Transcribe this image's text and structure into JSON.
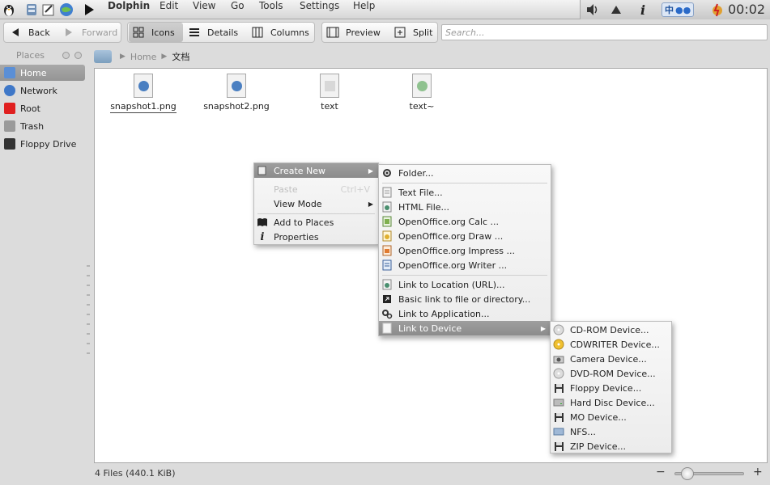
{
  "app": {
    "title": "Dolphin"
  },
  "menubar": [
    "Edit",
    "View",
    "Go",
    "Tools",
    "Settings",
    "Help"
  ],
  "tray": {
    "clock": "00:02",
    "input_method": "中",
    "info_glyph": "i"
  },
  "toolbar": {
    "back": "Back",
    "forward": "Forward",
    "icons": "Icons",
    "details": "Details",
    "columns": "Columns",
    "preview": "Preview",
    "split": "Split"
  },
  "search": {
    "placeholder": "Search..."
  },
  "places": {
    "title": "Places",
    "items": [
      {
        "label": "Home",
        "color": "#5b8fd6"
      },
      {
        "label": "Network",
        "color": "#3f78c8"
      },
      {
        "label": "Root",
        "color": "#e02020"
      },
      {
        "label": "Trash",
        "color": "#9a9a9a"
      },
      {
        "label": "Floppy Drive",
        "color": "#333333"
      }
    ]
  },
  "breadcrumb": {
    "home": "Home",
    "current": "文档"
  },
  "files": [
    {
      "name": "snapshot1.png",
      "badge": "#4a7fc1"
    },
    {
      "name": "snapshot2.png",
      "badge": "#4a7fc1"
    },
    {
      "name": "text",
      "badge": "#d8d8d8"
    },
    {
      "name": "text~",
      "badge": "#8fc28f"
    }
  ],
  "status": {
    "text": "4 Files (440.1 KiB)"
  },
  "context_menu": {
    "create_new": "Create New",
    "paste": "Paste",
    "paste_shortcut": "Ctrl+V",
    "view_mode": "View Mode",
    "add_to_places": "Add to Places",
    "properties": "Properties"
  },
  "create_new_menu": {
    "folder": "Folder...",
    "text_file": "Text File...",
    "html_file": "HTML File...",
    "calc": "OpenOffice.org Calc  ...",
    "draw": "OpenOffice.org Draw  ...",
    "impress": "OpenOffice.org Impress  ...",
    "writer": "OpenOffice.org Writer  ...",
    "link_url": "Link to Location (URL)...",
    "basic_link": "Basic link to file or directory...",
    "link_app": "Link to Application...",
    "link_device": "Link to Device"
  },
  "device_menu": [
    "CD-ROM Device...",
    "CDWRITER Device...",
    "Camera Device...",
    "DVD-ROM Device...",
    "Floppy Device...",
    "Hard Disc Device...",
    "MO Device...",
    "NFS...",
    "ZIP Device..."
  ]
}
